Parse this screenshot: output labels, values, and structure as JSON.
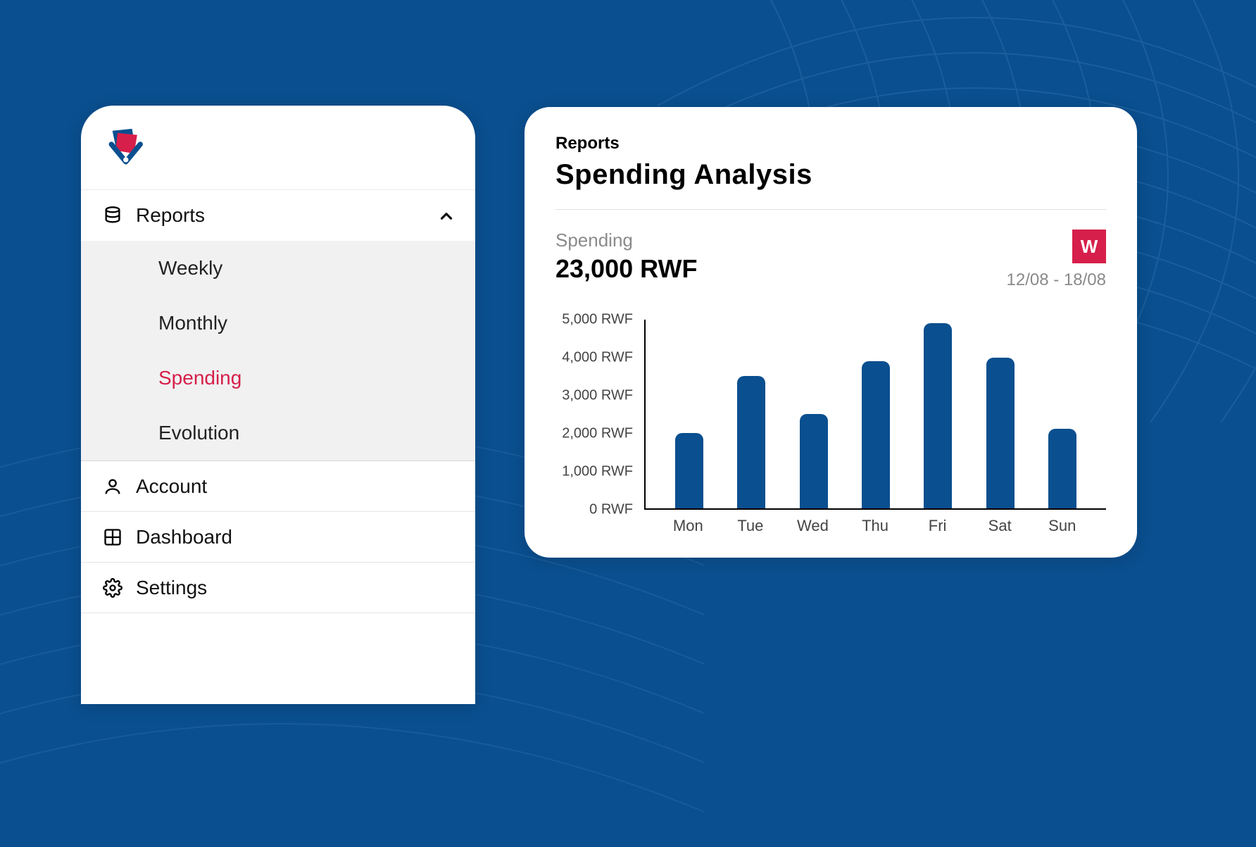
{
  "colors": {
    "brand_blue": "#0a4f8f",
    "accent_red": "#d61f4a"
  },
  "sidebar": {
    "items": [
      {
        "label": "Reports",
        "expanded": true,
        "sub": [
          {
            "label": "Weekly",
            "active": false
          },
          {
            "label": "Monthly",
            "active": false
          },
          {
            "label": "Spending",
            "active": true
          },
          {
            "label": "Evolution",
            "active": false
          }
        ]
      },
      {
        "label": "Account"
      },
      {
        "label": "Dashboard"
      },
      {
        "label": "Settings"
      }
    ]
  },
  "main": {
    "breadcrumb": "Reports",
    "title": "Spending  Analysis",
    "spending_label": "Spending",
    "spending_value": "23,000 RWF",
    "period_badge": "W",
    "date_range": "12/08 - 18/08"
  },
  "chart_data": {
    "type": "bar",
    "title": "Spending  Analysis",
    "xlabel": "",
    "ylabel": "",
    "y_unit": "RWF",
    "ylim": [
      0,
      5000
    ],
    "y_ticks": [
      0,
      1000,
      2000,
      3000,
      4000,
      5000
    ],
    "y_tick_labels": [
      "0 RWF",
      "1,000 RWF",
      "2,000 RWF",
      "3,000 RWF",
      "4,000 RWF",
      "5,000 RWF"
    ],
    "categories": [
      "Mon",
      "Tue",
      "Wed",
      "Thu",
      "Fri",
      "Sat",
      "Sun"
    ],
    "values": [
      2000,
      3500,
      2500,
      3900,
      4900,
      4000,
      2100
    ]
  }
}
